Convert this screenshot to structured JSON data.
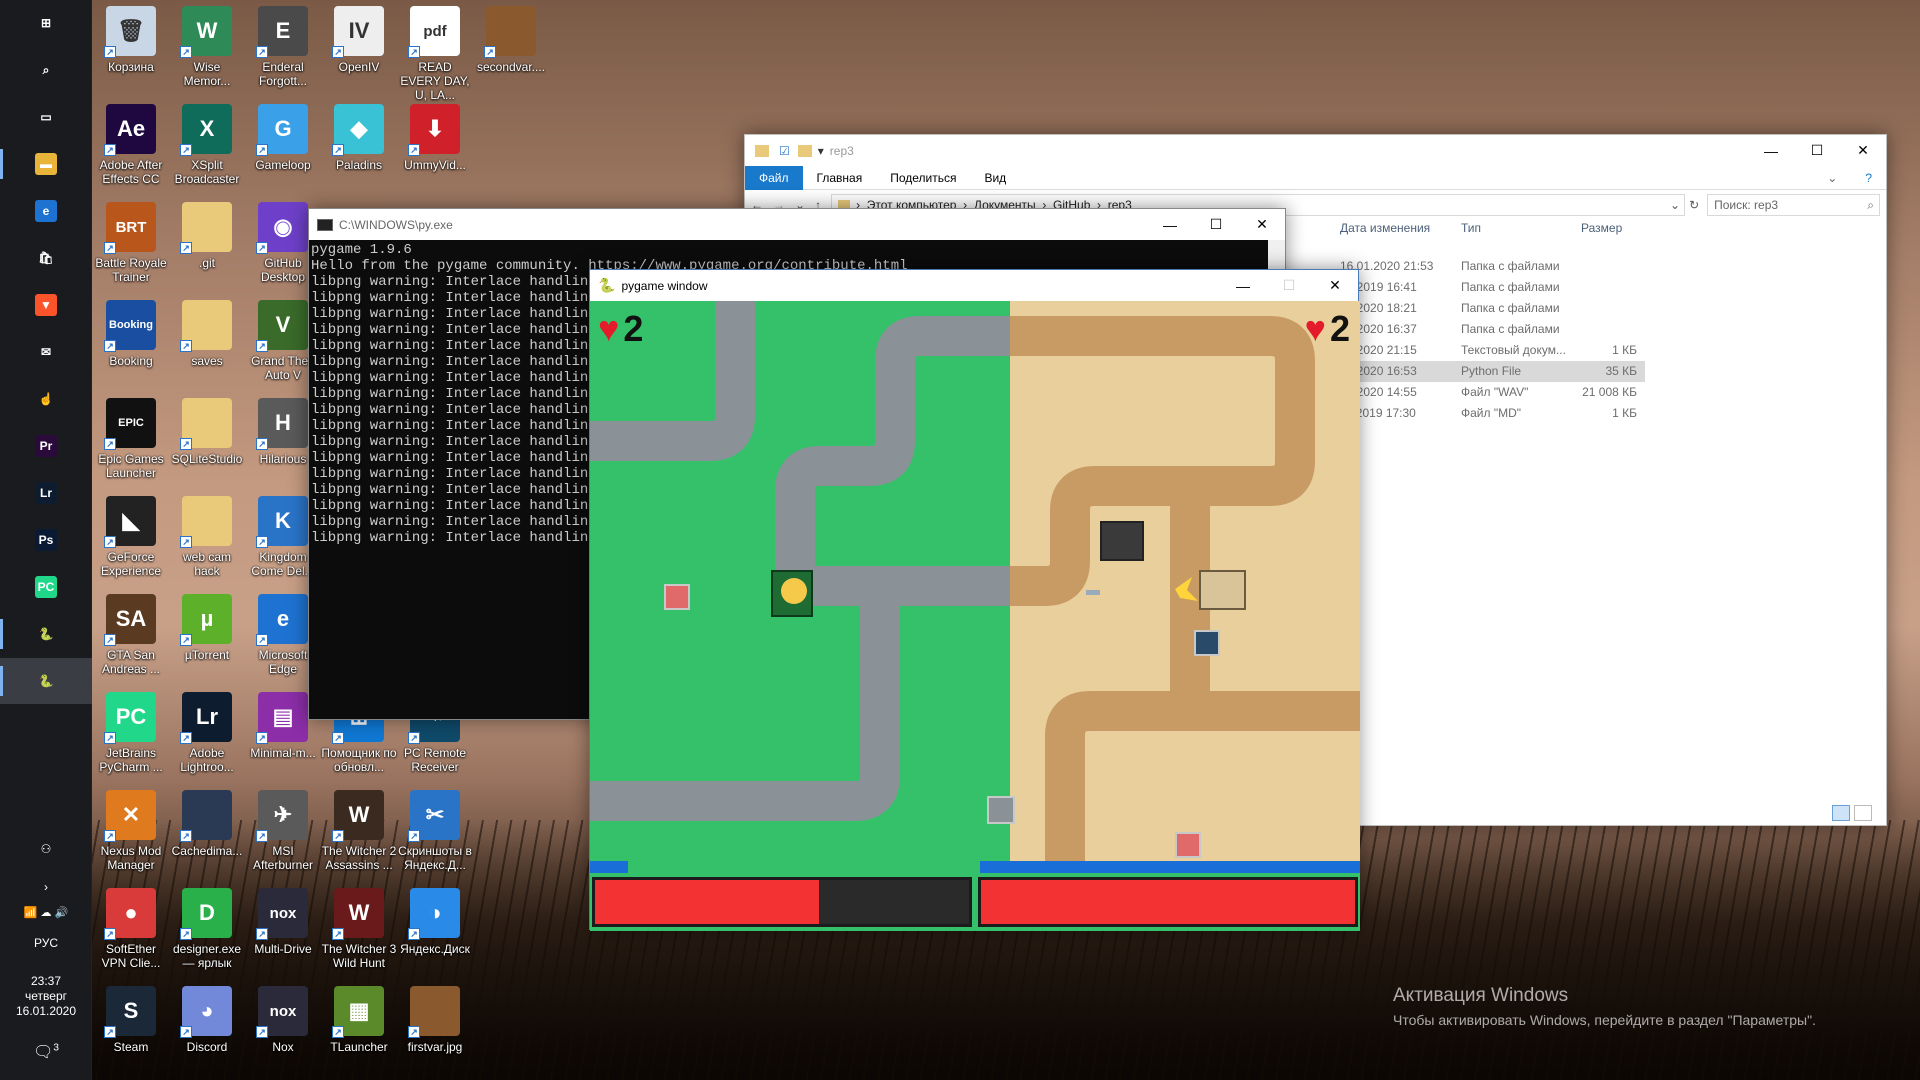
{
  "desktop_icons": [
    {
      "label": "Корзина",
      "glyph": "🗑",
      "color": "#c8d6e5",
      "icon": "recycle-bin-icon"
    },
    {
      "label": "Wise Memor...",
      "glyph": "W",
      "color": "#2e8b57",
      "icon": "wise-memory-icon"
    },
    {
      "label": "Enderal Forgott...",
      "glyph": "E",
      "color": "#4a4a4a",
      "icon": "enderal-icon"
    },
    {
      "label": "OpenIV",
      "glyph": "IV",
      "color": "#eeeeee",
      "icon": "openiv-icon"
    },
    {
      "label": "READ EVERY DAY, U, LA...",
      "glyph": "pdf",
      "color": "#ffffff",
      "icon": "pdf-icon"
    },
    {
      "label": "secondvar....",
      "glyph": "",
      "color": "#8a5a2e",
      "icon": "image-thumbnail-icon"
    },
    {
      "label": "Adobe After Effects CC",
      "glyph": "Ae",
      "color": "#1f0740",
      "icon": "after-effects-icon"
    },
    {
      "label": "XSplit Broadcaster",
      "glyph": "X",
      "color": "#0f6b5a",
      "icon": "xsplit-icon"
    },
    {
      "label": "Gameloop",
      "glyph": "G",
      "color": "#3aa0e8",
      "icon": "gameloop-icon"
    },
    {
      "label": "Paladins",
      "glyph": "◆",
      "color": "#39c1d6",
      "icon": "paladins-icon"
    },
    {
      "label": "UmmyVid...",
      "glyph": "⬇",
      "color": "#d0202a",
      "icon": "ummy-video-icon"
    },
    {
      "label": "Battle Royale Trainer",
      "glyph": "BRT",
      "color": "#b8561c",
      "icon": "brt-icon"
    },
    {
      "label": ".git",
      "glyph": "",
      "color": "#e9c97a",
      "icon": "folder-icon"
    },
    {
      "label": "GitHub Desktop",
      "glyph": "◉",
      "color": "#6e40c9",
      "icon": "github-desktop-icon"
    },
    {
      "label": "Booking",
      "glyph": "Booking",
      "color": "#1a4ea0",
      "icon": "booking-icon"
    },
    {
      "label": "saves",
      "glyph": "",
      "color": "#e9c97a",
      "icon": "folder-icon"
    },
    {
      "label": "Grand Theft Auto V",
      "glyph": "V",
      "color": "#3a6b2a",
      "icon": "gta5-icon"
    },
    {
      "label": "Epic Games Launcher",
      "glyph": "EPIC",
      "color": "#111111",
      "icon": "epic-games-icon"
    },
    {
      "label": "SQLiteStudio",
      "glyph": "",
      "color": "#e9c97a",
      "icon": "folder-icon"
    },
    {
      "label": "Hilarious",
      "glyph": "H",
      "color": "#5a5a5a",
      "icon": "hilarious-icon"
    },
    {
      "label": "GeForce Experience",
      "glyph": "◣",
      "color": "#222222",
      "icon": "geforce-icon"
    },
    {
      "label": "web cam hack",
      "glyph": "",
      "color": "#e9c97a",
      "icon": "folder-icon"
    },
    {
      "label": "Kingdom Come Del...",
      "glyph": "K",
      "color": "#2a74c8",
      "icon": "kingdom-come-icon"
    },
    {
      "label": "GTA San Andreas ...",
      "glyph": "SA",
      "color": "#5a3a20",
      "icon": "gta-sa-icon"
    },
    {
      "label": "µTorrent",
      "glyph": "µ",
      "color": "#5cb02a",
      "icon": "utorrent-icon"
    },
    {
      "label": "Microsoft Edge",
      "glyph": "e",
      "color": "#1e73d2",
      "icon": "edge-icon"
    },
    {
      "label": "JetBrains PyCharm ...",
      "glyph": "PC",
      "color": "#21d789",
      "icon": "pycharm-icon"
    },
    {
      "label": "Adobe Lightroo...",
      "glyph": "Lr",
      "color": "#0d1c2e",
      "icon": "lightroom-icon"
    },
    {
      "label": "Minimal-m...",
      "glyph": "▤",
      "color": "#8b2ea8",
      "icon": "winrar-icon"
    },
    {
      "label": "Помощник по обновл...",
      "glyph": "⊞",
      "color": "#0f78d4",
      "icon": "update-assistant-icon"
    },
    {
      "label": "PC Remote Receiver",
      "glyph": "⌁",
      "color": "#0f4a6a",
      "icon": "pc-remote-icon"
    },
    {
      "label": "Nexus Mod Manager",
      "glyph": "✕",
      "color": "#e07a1e",
      "icon": "nexus-mod-icon"
    },
    {
      "label": "Cachedima...",
      "glyph": "",
      "color": "#2a3a55",
      "icon": "image-thumbnail-icon"
    },
    {
      "label": "MSI Afterburner",
      "glyph": "✈",
      "color": "#5a5a5a",
      "icon": "msi-afterburner-icon"
    },
    {
      "label": "The Witcher 2 Assassins ...",
      "glyph": "W",
      "color": "#3a2a20",
      "icon": "witcher2-icon"
    },
    {
      "label": "Скриншоты в Яндекс.Д...",
      "glyph": "✂",
      "color": "#2a74c8",
      "icon": "yandex-screenshots-icon"
    },
    {
      "label": "SoftEther VPN Clie...",
      "glyph": "●",
      "color": "#d93a3a",
      "icon": "softether-icon"
    },
    {
      "label": "designer.exe — ярлык",
      "glyph": "D",
      "color": "#2ab04a",
      "icon": "designer-icon"
    },
    {
      "label": "Multi-Drive",
      "glyph": "nox",
      "color": "#2a2a3a",
      "icon": "nox-multi-icon"
    },
    {
      "label": "The Witcher 3 Wild Hunt",
      "glyph": "W",
      "color": "#6a1a1a",
      "icon": "witcher3-icon"
    },
    {
      "label": "Яндекс.Диск",
      "glyph": "◑",
      "color": "#2a8ae8",
      "icon": "yandex-disk-icon"
    },
    {
      "label": "Steam",
      "glyph": "S",
      "color": "#1b2838",
      "icon": "steam-icon"
    },
    {
      "label": "Discord",
      "glyph": "◕",
      "color": "#7289da",
      "icon": "discord-icon"
    },
    {
      "label": "Nox",
      "glyph": "nox",
      "color": "#2a2a3a",
      "icon": "nox-icon"
    },
    {
      "label": "TLauncher",
      "glyph": "▦",
      "color": "#5a8a2a",
      "icon": "tlauncher-icon"
    },
    {
      "label": "firstvar.jpg",
      "glyph": "",
      "color": "#8a5a2e",
      "icon": "image-thumbnail-icon"
    }
  ],
  "taskbar": {
    "items": [
      {
        "name": "start-button",
        "glyph": "⊞",
        "color": "transparent"
      },
      {
        "name": "search-button",
        "glyph": "⌕",
        "color": "transparent"
      },
      {
        "name": "task-view-button",
        "glyph": "▭",
        "color": "transparent"
      },
      {
        "name": "file-explorer-button",
        "glyph": "▬",
        "color": "#e9b43a",
        "open": true
      },
      {
        "name": "edge-button",
        "glyph": "e",
        "color": "#1e73d2"
      },
      {
        "name": "store-button",
        "glyph": "🛍",
        "color": "transparent"
      },
      {
        "name": "brave-button",
        "glyph": "▼",
        "color": "#fb542b"
      },
      {
        "name": "mail-button",
        "glyph": "✉",
        "color": "transparent"
      },
      {
        "name": "touch-button",
        "glyph": "☝",
        "color": "transparent"
      },
      {
        "name": "premiere-button",
        "glyph": "Pr",
        "color": "#2a0a3a"
      },
      {
        "name": "lightroom-button",
        "glyph": "Lr",
        "color": "#0d1c2e"
      },
      {
        "name": "photoshop-button",
        "glyph": "Ps",
        "color": "#0a1a33"
      },
      {
        "name": "pycharm-button",
        "glyph": "PC",
        "color": "#21d789"
      },
      {
        "name": "python-button",
        "glyph": "🐍",
        "color": "transparent",
        "open": true
      },
      {
        "name": "pygame-button",
        "glyph": "🐍",
        "color": "transparent",
        "open": true,
        "active": true
      }
    ],
    "lang": "РУС",
    "time": "23:37",
    "weekday": "четверг",
    "date": "16.01.2020",
    "notifications": "3"
  },
  "explorer": {
    "title": "rep3",
    "menu": [
      "Файл",
      "Главная",
      "Поделиться",
      "Вид"
    ],
    "breadcrumb": [
      "Этот компьютер",
      "Документы",
      "GitHub",
      "rep3"
    ],
    "search_placeholder": "Поиск: rep3",
    "columns": {
      "date": "Дата изменения",
      "type": "Тип",
      "size": "Размер"
    },
    "rows": [
      {
        "date": "16.01.2020 21:53",
        "type": "Папка с файлами",
        "size": ""
      },
      {
        "date": "12.2019 16:41",
        "type": "Папка с файлами",
        "size": ""
      },
      {
        "date": "01.2020 18:21",
        "type": "Папка с файлами",
        "size": ""
      },
      {
        "date": "01.2020 16:37",
        "type": "Папка с файлами",
        "size": ""
      },
      {
        "date": "01.2020 21:15",
        "type": "Текстовый докум...",
        "size": "1 КБ"
      },
      {
        "date": "01.2020 16:53",
        "type": "Python File",
        "size": "35 КБ",
        "selected": true
      },
      {
        "date": "01.2020 14:55",
        "type": "Файл \"WAV\"",
        "size": "21 008 КБ"
      },
      {
        "date": "11.2019 17:30",
        "type": "Файл \"MD\"",
        "size": "1 КБ"
      }
    ]
  },
  "console": {
    "title": "C:\\WINDOWS\\py.exe",
    "lines": [
      "pygame 1.9.6",
      "Hello from the pygame community. https://www.pygame.org/contribute.html",
      "libpng warning: Interlace handling",
      "libpng warning: Interlace handling",
      "libpng warning: Interlace handling",
      "libpng warning: Interlace handling",
      "libpng warning: Interlace handling",
      "libpng warning: Interlace handling",
      "libpng warning: Interlace handling",
      "libpng warning: Interlace handling",
      "libpng warning: Interlace handling",
      "libpng warning: Interlace handling",
      "libpng warning: Interlace handling",
      "libpng warning: Interlace handling",
      "libpng warning: Interlace handling",
      "libpng warning: Interlace handling",
      "libpng warning: Interlace handling",
      "libpng warning: Interlace handling",
      "libpng warning: Interlace handling"
    ]
  },
  "pygame": {
    "title": "pygame window",
    "left_lives": "2",
    "right_lives": "2",
    "left_health": 0.6,
    "right_health": 1.0,
    "left_reload": 0.1,
    "right_reload": 1.0,
    "colors": {
      "grass": "#35c06a",
      "sand": "#e8cf9c",
      "road_gray": "#8a9298",
      "road_dirt": "#c89a64",
      "health": "#f33333",
      "reload": "#1a6ed8"
    }
  },
  "watermark": {
    "title": "Активация Windows",
    "text": "Чтобы активировать Windows, перейдите в раздел \"Параметры\"."
  }
}
